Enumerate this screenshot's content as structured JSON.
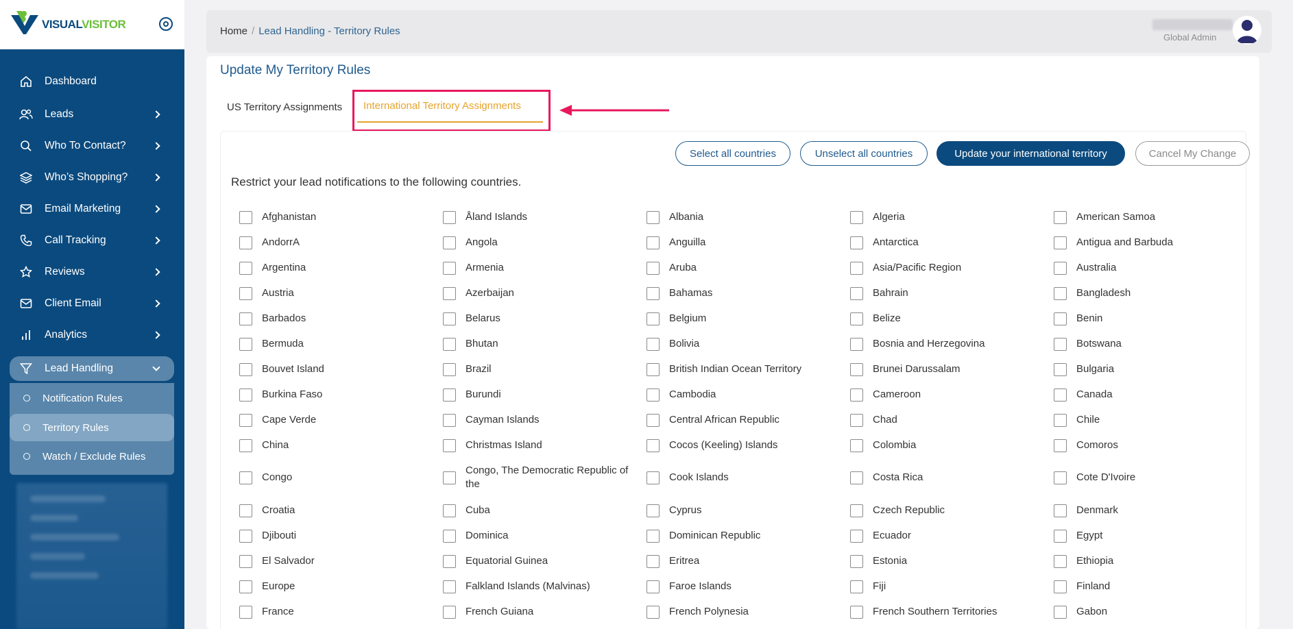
{
  "app": {
    "logo_text_part1": "VISUAL",
    "logo_text_part2": "VISITOR"
  },
  "sidebar": {
    "items": [
      {
        "label": "Dashboard",
        "icon": "home-icon",
        "has_chevron": false
      },
      {
        "label": "Leads",
        "icon": "users-icon",
        "has_chevron": true
      },
      {
        "label": "Who To Contact?",
        "icon": "search-icon",
        "has_chevron": true
      },
      {
        "label": "Who’s Shopping?",
        "icon": "layers-icon",
        "has_chevron": true
      },
      {
        "label": "Email Marketing",
        "icon": "mail-icon",
        "has_chevron": true
      },
      {
        "label": "Call Tracking",
        "icon": "phone-icon",
        "has_chevron": true
      },
      {
        "label": "Reviews",
        "icon": "star-icon",
        "has_chevron": true
      },
      {
        "label": "Client Email",
        "icon": "mail-icon",
        "has_chevron": true
      },
      {
        "label": "Analytics",
        "icon": "bar-chart-icon",
        "has_chevron": true
      },
      {
        "label": "Lead Handling",
        "icon": "filter-icon",
        "has_chevron": true
      }
    ],
    "lead_handling_sub": [
      {
        "label": "Notification Rules"
      },
      {
        "label": "Territory Rules"
      },
      {
        "label": "Watch / Exclude Rules"
      }
    ]
  },
  "header": {
    "breadcrumb_home": "Home",
    "breadcrumb_sep": "/",
    "breadcrumb_current": "Lead Handling - Territory Rules",
    "user_role": "Global Admin"
  },
  "main": {
    "title": "Update My Territory Rules",
    "tabs": [
      {
        "label": "US Territory Assignments"
      },
      {
        "label": "International Territory Assignments"
      }
    ],
    "buttons": {
      "select_all": "Select all countries",
      "unselect_all": "Unselect all countries",
      "update": "Update your international territory",
      "cancel": "Cancel My Change"
    },
    "restrict_text": "Restrict your lead notifications to the following countries.",
    "countries": [
      [
        "Afghanistan",
        "Åland Islands",
        "Albania",
        "Algeria",
        "American Samoa"
      ],
      [
        "AndorrA",
        "Angola",
        "Anguilla",
        "Antarctica",
        "Antigua and Barbuda"
      ],
      [
        "Argentina",
        "Armenia",
        "Aruba",
        "Asia/Pacific Region",
        "Australia"
      ],
      [
        "Austria",
        "Azerbaijan",
        "Bahamas",
        "Bahrain",
        "Bangladesh"
      ],
      [
        "Barbados",
        "Belarus",
        "Belgium",
        "Belize",
        "Benin"
      ],
      [
        "Bermuda",
        "Bhutan",
        "Bolivia",
        "Bosnia and Herzegovina",
        "Botswana"
      ],
      [
        "Bouvet Island",
        "Brazil",
        "British Indian Ocean Territory",
        "Brunei Darussalam",
        "Bulgaria"
      ],
      [
        "Burkina Faso",
        "Burundi",
        "Cambodia",
        "Cameroon",
        "Canada"
      ],
      [
        "Cape Verde",
        "Cayman Islands",
        "Central African Republic",
        "Chad",
        "Chile"
      ],
      [
        "China",
        "Christmas Island",
        "Cocos (Keeling) Islands",
        "Colombia",
        "Comoros"
      ],
      [
        "Congo",
        "Congo, The Democratic Republic of the",
        "Cook Islands",
        "Costa Rica",
        "Cote D'Ivoire"
      ],
      [
        "Croatia",
        "Cuba",
        "Cyprus",
        "Czech Republic",
        "Denmark"
      ],
      [
        "Djibouti",
        "Dominica",
        "Dominican Republic",
        "Ecuador",
        "Egypt"
      ],
      [
        "El Salvador",
        "Equatorial Guinea",
        "Eritrea",
        "Estonia",
        "Ethiopia"
      ],
      [
        "Europe",
        "Falkland Islands (Malvinas)",
        "Faroe Islands",
        "Fiji",
        "Finland"
      ],
      [
        "France",
        "French Guiana",
        "French Polynesia",
        "French Southern Territories",
        "Gabon"
      ]
    ],
    "colors": {
      "sidebar_bg": "#0b4a7e",
      "active_tab": "#e5a42e",
      "highlight": "#e8185c",
      "primary": "#0b4a7e"
    }
  }
}
